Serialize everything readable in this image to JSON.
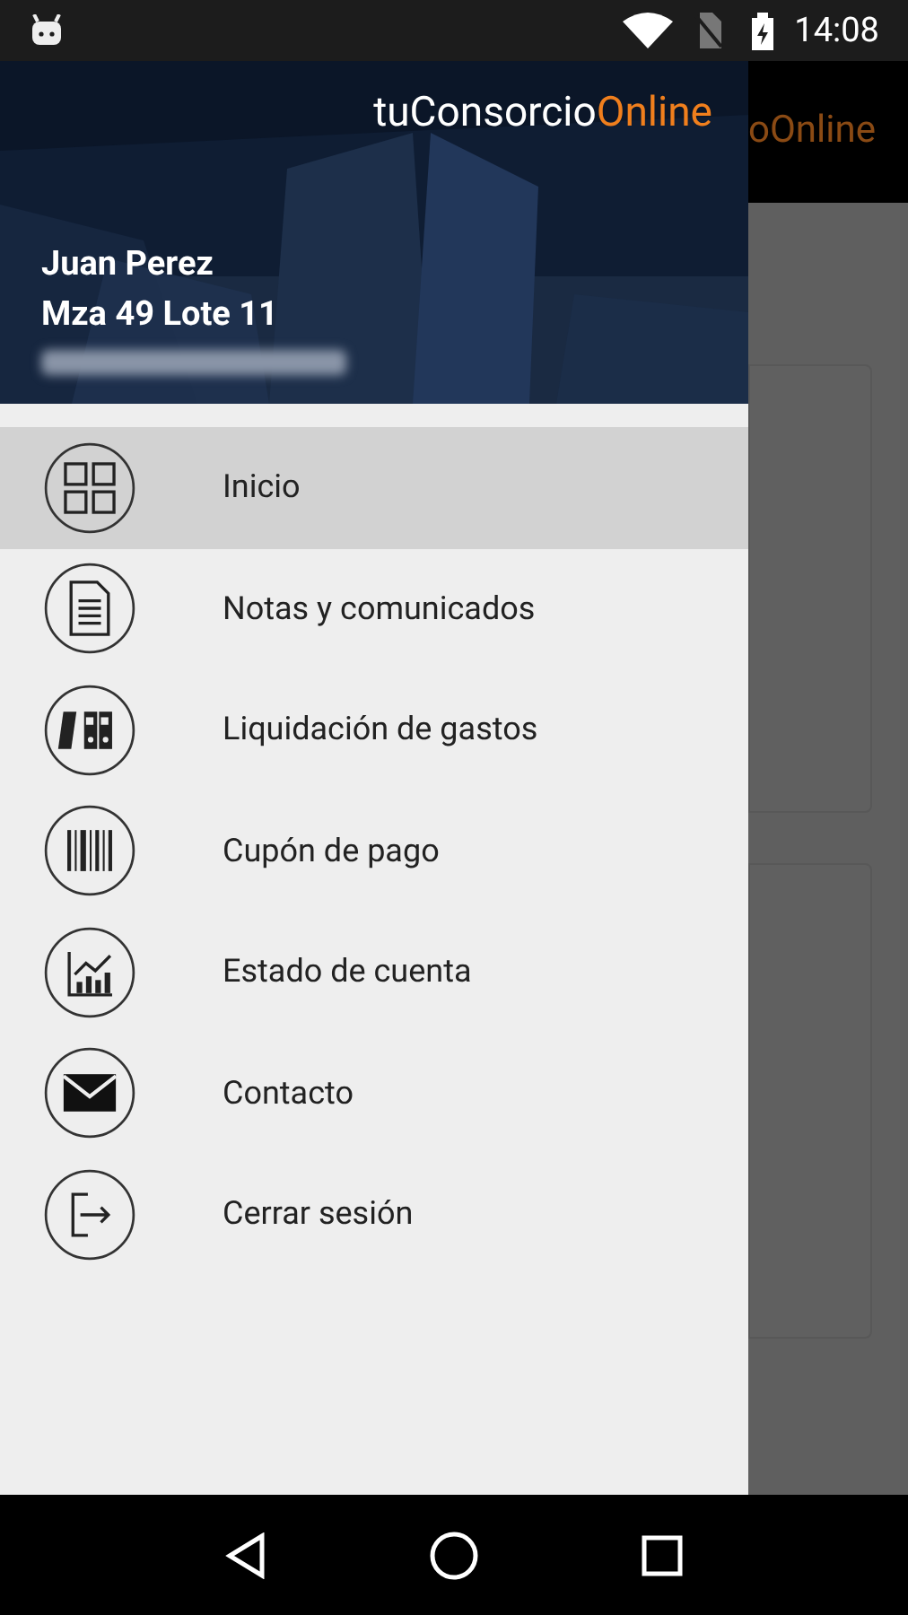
{
  "status_bar": {
    "time": "14:08"
  },
  "background_app": {
    "title_fragment": "oOnline"
  },
  "drawer": {
    "brand": {
      "prefix": "tuConsorcio",
      "suffix": "Online"
    },
    "user": {
      "name": "Juan Perez",
      "unit": "Mza 49 Lote 11"
    },
    "items": [
      {
        "label": "Inicio",
        "selected": true
      },
      {
        "label": "Notas y comunicados",
        "selected": false
      },
      {
        "label": "Liquidación de gastos",
        "selected": false
      },
      {
        "label": "Cupón de pago",
        "selected": false
      },
      {
        "label": "Estado de cuenta",
        "selected": false
      },
      {
        "label": "Contacto",
        "selected": false
      },
      {
        "label": "Cerrar sesión",
        "selected": false
      }
    ]
  }
}
